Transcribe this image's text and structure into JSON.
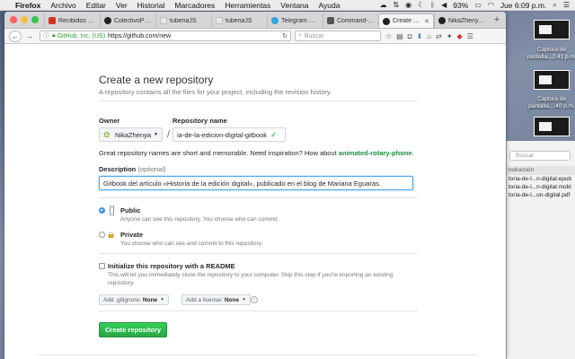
{
  "menubar": {
    "items": [
      "Firefox",
      "Archivo",
      "Editar",
      "Ver",
      "Historial",
      "Marcadores",
      "Herramientas",
      "Ventana",
      "Ayuda"
    ],
    "battery": "93%",
    "clock": "Jue 6:09 p.m."
  },
  "browser": {
    "tabs": [
      {
        "label": "Recibidos (2) ...",
        "icon": "gmail-icon",
        "color": "#d93025"
      },
      {
        "label": "ColectivoPerr...",
        "icon": "github-icon",
        "color": "#222222"
      },
      {
        "label": "tuberiaJS",
        "icon": "page-icon",
        "color": "#e8e8e8"
      },
      {
        "label": "tuberiaJS",
        "icon": "page-icon",
        "color": "#e8e8e8"
      },
      {
        "label": "Telegram Web",
        "icon": "telegram-icon",
        "color": "#2ca5e0"
      },
      {
        "label": "Command-lin...",
        "icon": "doc-icon",
        "color": "#555555"
      },
      {
        "label": "Create a ...",
        "icon": "github-icon",
        "color": "#222222"
      },
      {
        "label": "NikaZhenya/h...",
        "icon": "github-icon",
        "color": "#222222"
      }
    ],
    "address": {
      "org": "GitHub, Inc. (US)",
      "url": "https://github.com/new"
    },
    "search_placeholder": "Buscar"
  },
  "form": {
    "title": "Create a new repository",
    "subtitle": "A repository contains all the files for your project, including the revision history.",
    "owner_label": "Owner",
    "owner_value": "NikaZhenya",
    "slash": "/",
    "repo_label": "Repository name",
    "repo_value": "ia-de-la-edicion-digital-gitbook",
    "hint_prefix": "Great repository names are short and memorable. Need inspiration? How about",
    "hint_suggestion": "animated-rotary-phone",
    "hint_suffix": ".",
    "description_label": "Description",
    "description_optional": "(optional)",
    "description_value": "Gitbook del artículo «Historia de la edición digital», publicado en el blog de Mariana Eguaras.",
    "public_label": "Public",
    "public_desc": "Anyone can see this repository. You choose who can commit.",
    "private_label": "Private",
    "private_desc": "You choose who can see and commit to this repository.",
    "readme_label": "Initialize this repository with a README",
    "readme_desc1": "This will let you immediately clone the repository to your computer. Skip this step if you're importing an existing",
    "readme_desc2": "repository.",
    "gitignore_prefix": "Add .gitignore:",
    "gitignore_value": "None",
    "license_prefix": "Add a license:",
    "license_value": "None",
    "info_glyph": "i",
    "submit_label": "Create repository",
    "visibility": "public",
    "readme_checked": false
  },
  "desktop": {
    "icons": [
      {
        "caption1": "Captura de",
        "caption2": "pantalla...2.41 p.m."
      },
      {
        "caption1": "Captura de",
        "caption2": "pantalla....40 p.m."
      }
    ]
  },
  "finder": {
    "search_placeholder": "Buscar",
    "header": "roducción",
    "files": [
      "toria-de-l...n-digital.epub",
      "toria-de-l...n-digital.mobi",
      "toria-de-l...on-digital.pdf"
    ]
  },
  "colors": {
    "accent": "#28a745",
    "link": "#1e8e3e",
    "focus": "#51a7e8"
  }
}
